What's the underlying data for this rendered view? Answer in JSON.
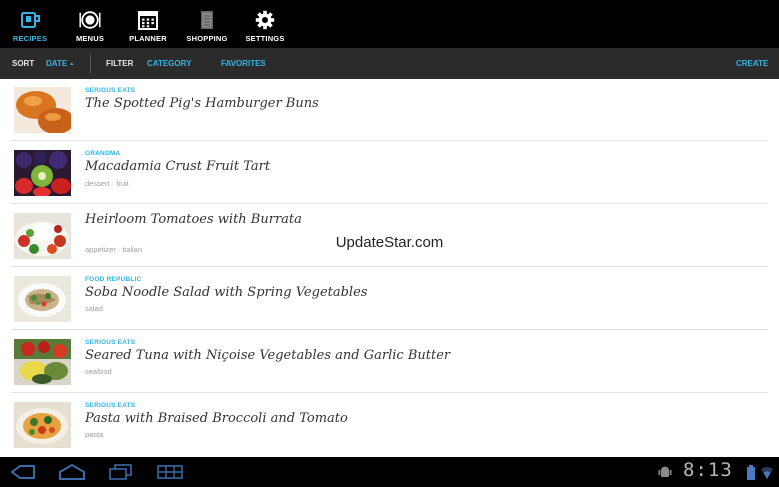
{
  "nav": {
    "items": [
      {
        "label": "RECIPES",
        "icon": "recipes-icon",
        "active": true
      },
      {
        "label": "MENUS",
        "icon": "menus-icon"
      },
      {
        "label": "PLANNER",
        "icon": "planner-icon"
      },
      {
        "label": "SHOPPING",
        "icon": "shopping-icon"
      },
      {
        "label": "SETTINGS",
        "icon": "settings-icon"
      }
    ]
  },
  "toolbar": {
    "sort_label": "SORT",
    "sort_value": "DATE",
    "sort_arrow": "▲",
    "filter_label": "FILTER",
    "category": "CATEGORY",
    "favorites": "FAVORITES",
    "create": "CREATE"
  },
  "recipes": [
    {
      "source": "SERIOUS EATS",
      "title": "The Spotted Pig's Hamburger Buns",
      "tags": ""
    },
    {
      "source": "GRANDMA",
      "title": "Macadamia Crust Fruit Tart",
      "tags": "dessert · fruit"
    },
    {
      "source": "",
      "title": "Heirloom Tomatoes with Burrata",
      "tags": "appetizer · italian"
    },
    {
      "source": "FOOD REPUBLIC",
      "title": "Soba Noodle Salad with Spring Vegetables",
      "tags": "salad"
    },
    {
      "source": "SERIOUS EATS",
      "title": "Seared Tuna with Niçoise Vegetables and Garlic Butter",
      "tags": "seafood"
    },
    {
      "source": "SERIOUS EATS",
      "title": "Pasta with Braised Broccoli and Tomato",
      "tags": "pasta"
    }
  ],
  "watermark": "UpdateStar.com",
  "status": {
    "time": "8:13"
  },
  "colors": {
    "accent": "#33b5e5",
    "toolbar": "#2b2b2b",
    "background": "#000000"
  }
}
